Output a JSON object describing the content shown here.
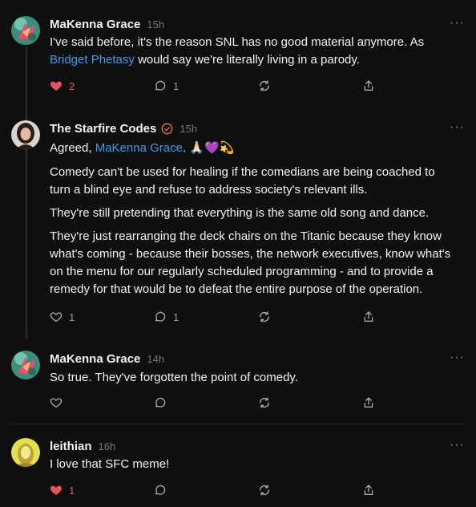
{
  "colors": {
    "background": "#0f0f0f",
    "text": "#f3f3f3",
    "link": "#3d9bf0",
    "muted": "#777777",
    "heart": "#e8515d"
  },
  "posts": [
    {
      "name": "MaKenna Grace",
      "time": "15h",
      "text_before": "I've said before, it's the reason SNL has no good material anymore. As ",
      "link": "Bridget Phetasy",
      "text_after": " would say we're literally living in a parody.",
      "likes": "2",
      "liked": true,
      "comments": "1"
    },
    {
      "name": "The Starfire Codes",
      "time": "15h",
      "badge": "verified-check-icon",
      "line1_before": "Agreed, ",
      "line1_link": "MaKenna Grace",
      "line1_after": ". 🙏🏻💜💫",
      "paragraphs": [
        "Comedy can't be used for healing if the comedians are being coached to turn a blind eye and refuse to address society's relevant ills.",
        "They're still pretending that everything is the same old song and dance.",
        "They're just rearranging the deck chairs on the Titanic because they know what's coming - because their bosses, the network executives, know what's on the menu for our regularly scheduled programming - and to provide a remedy for that would be to defeat the entire purpose of the operation."
      ],
      "likes": "1",
      "liked": false,
      "comments": "1"
    },
    {
      "name": "MaKenna Grace",
      "time": "14h",
      "text": "So true. They've forgotten the point of comedy."
    },
    {
      "name": "leithian",
      "time": "16h",
      "text": "I love that SFC meme!",
      "likes": "1",
      "liked": true
    }
  ],
  "more_label": "···"
}
